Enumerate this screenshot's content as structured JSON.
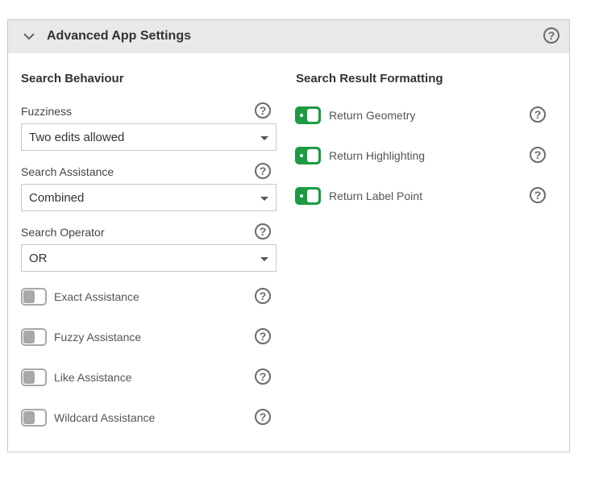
{
  "panel": {
    "title": "Advanced App Settings",
    "collapse_icon": "chevron-down-icon",
    "help_icon": "question-circle-icon"
  },
  "search_behaviour": {
    "title": "Search Behaviour",
    "fuzziness": {
      "label": "Fuzziness",
      "value": "Two edits allowed"
    },
    "search_assistance": {
      "label": "Search Assistance",
      "value": "Combined"
    },
    "search_operator": {
      "label": "Search Operator",
      "value": "OR"
    },
    "toggles": [
      {
        "label": "Exact Assistance",
        "state": "off"
      },
      {
        "label": "Fuzzy Assistance",
        "state": "off"
      },
      {
        "label": "Like Assistance",
        "state": "off"
      },
      {
        "label": "Wildcard Assistance",
        "state": "off"
      }
    ]
  },
  "search_result_formatting": {
    "title": "Search Result Formatting",
    "toggles": [
      {
        "label": "Return Geometry",
        "state": "on"
      },
      {
        "label": "Return Highlighting",
        "state": "on"
      },
      {
        "label": "Return Label Point",
        "state": "on"
      }
    ]
  },
  "colors": {
    "toggle_on": "#1e9b42",
    "toggle_off": "#a8a8a8",
    "header_bg": "#e9e9e9"
  }
}
